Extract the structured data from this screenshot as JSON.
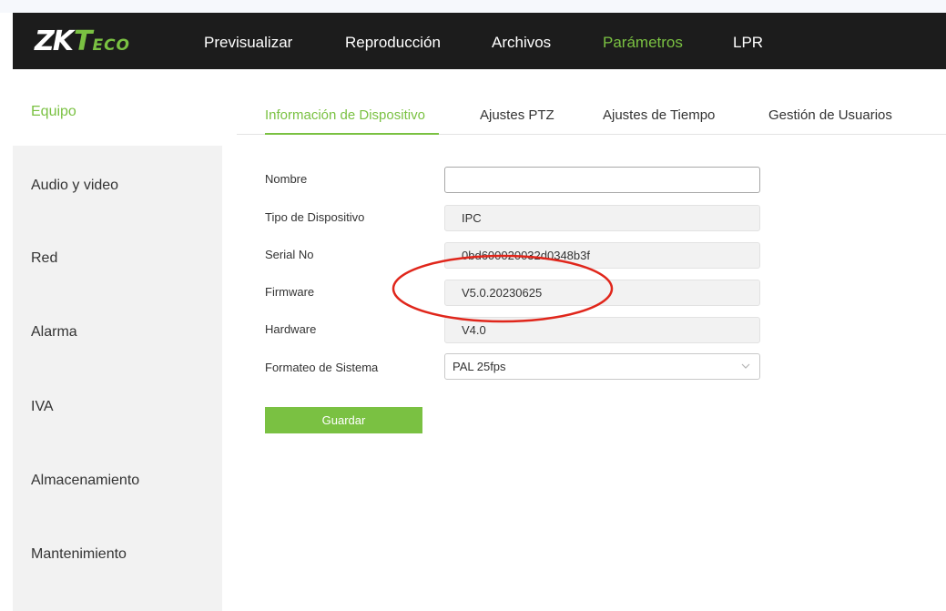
{
  "brand": {
    "logo_main": "ZK",
    "logo_t": "T",
    "logo_eco": "ECO"
  },
  "nav": {
    "items": [
      {
        "label": "Previsualizar"
      },
      {
        "label": "Reproducción"
      },
      {
        "label": "Archivos"
      },
      {
        "label": "Parámetros",
        "active": true
      },
      {
        "label": "LPR"
      }
    ]
  },
  "sidebar": {
    "items": [
      {
        "label": "Equipo",
        "active": true
      },
      {
        "label": "Audio y video"
      },
      {
        "label": "Red"
      },
      {
        "label": "Alarma"
      },
      {
        "label": "IVA"
      },
      {
        "label": "Almacenamiento"
      },
      {
        "label": "Mantenimiento"
      }
    ]
  },
  "tabs": [
    {
      "label": "Información de Dispositivo",
      "active": true
    },
    {
      "label": "Ajustes PTZ"
    },
    {
      "label": "Ajustes de Tiempo"
    },
    {
      "label": "Gestión de Usuarios"
    }
  ],
  "form": {
    "name_label": "Nombre",
    "name_value": "",
    "type_label": "Tipo de Dispositivo",
    "type_value": "IPC",
    "serial_label": "Serial No",
    "serial_value": "0bd600020032d0348b3f",
    "firmware_label": "Firmware",
    "firmware_value": "V5.0.20230625",
    "hardware_label": "Hardware",
    "hardware_value": "V4.0",
    "format_label": "Formateo de Sistema",
    "format_value": "PAL 25fps",
    "save_label": "Guardar"
  },
  "colors": {
    "accent": "#7ac142",
    "header_bg": "#1c1c1c",
    "annotation": "#e0261b"
  }
}
